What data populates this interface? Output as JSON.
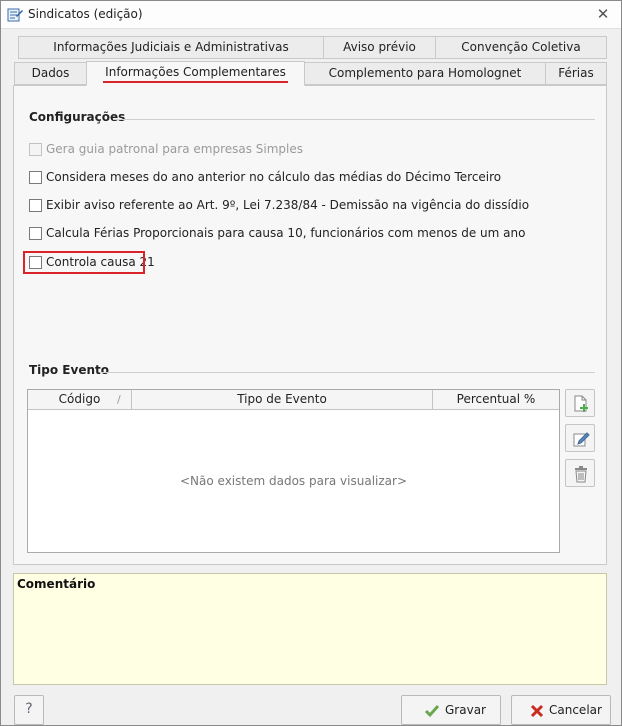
{
  "window": {
    "title": "Sindicatos (edição)"
  },
  "tabs": {
    "row1": [
      "Informações Judiciais e Administrativas",
      "Aviso prévio",
      "Convenção Coletiva"
    ],
    "row2": [
      "Dados",
      "Informações Complementares",
      "Complemento para Homolognet",
      "Férias"
    ],
    "active": "Informações Complementares"
  },
  "config": {
    "title": "Configurações",
    "options": [
      {
        "label": "Gera guia patronal para empresas Simples",
        "checked": false,
        "enabled": false
      },
      {
        "label": "Considera meses do ano anterior no cálculo das médias do Décimo Terceiro",
        "checked": false,
        "enabled": true
      },
      {
        "label": "Exibir aviso referente ao Art. 9º, Lei 7.238/84 - Demissão na vigência do dissídio",
        "checked": false,
        "enabled": true
      },
      {
        "label": "Calcula Férias Proporcionais para causa 10, funcionários com menos de um ano",
        "checked": false,
        "enabled": true
      },
      {
        "label": "Controla causa 21",
        "checked": false,
        "enabled": true,
        "highlighted": true
      }
    ]
  },
  "tipo_evento": {
    "title": "Tipo Evento",
    "columns": [
      "Código",
      "Tipo de Evento",
      "Percentual %"
    ],
    "sort_mark": "/",
    "empty_message": "<Não existem dados para visualizar>"
  },
  "comment": {
    "title": "Comentário"
  },
  "buttons": {
    "help": "?",
    "save": "Gravar",
    "cancel": "Cancelar"
  },
  "colors": {
    "highlight": "#d9242b",
    "comment_bg": "#ffffe4",
    "save_check": "#6aa84f",
    "cancel_x": "#cc2a1f"
  }
}
